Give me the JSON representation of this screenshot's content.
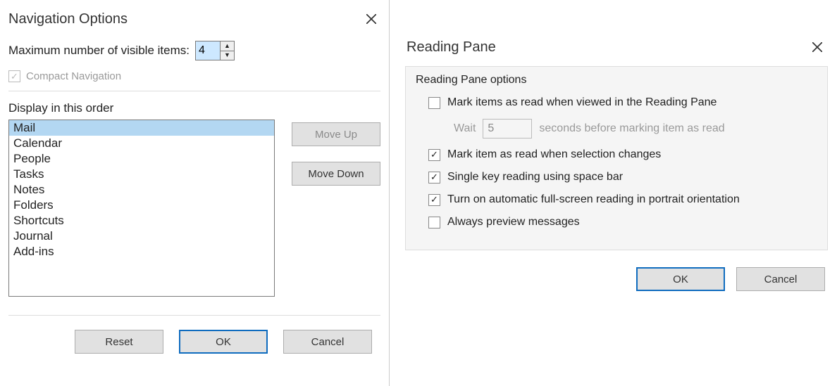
{
  "nav": {
    "title": "Navigation Options",
    "max_label": "Maximum number of visible items:",
    "max_value": "4",
    "compact_label": "Compact Navigation",
    "compact_checked": true,
    "compact_disabled": true,
    "display_label": "Display in this order",
    "items": [
      {
        "label": "Mail",
        "selected": true
      },
      {
        "label": "Calendar",
        "selected": false
      },
      {
        "label": "People",
        "selected": false
      },
      {
        "label": "Tasks",
        "selected": false
      },
      {
        "label": "Notes",
        "selected": false
      },
      {
        "label": "Folders",
        "selected": false
      },
      {
        "label": "Shortcuts",
        "selected": false
      },
      {
        "label": "Journal",
        "selected": false
      },
      {
        "label": "Add-ins",
        "selected": false
      }
    ],
    "move_up": "Move Up",
    "move_down": "Move Down",
    "reset": "Reset",
    "ok": "OK",
    "cancel": "Cancel"
  },
  "rp": {
    "title": "Reading Pane",
    "group_title": "Reading Pane options",
    "opt_mark_viewed": {
      "label": "Mark items as read when viewed in the Reading Pane",
      "checked": false
    },
    "wait_prefix": "Wait",
    "wait_value": "5",
    "wait_suffix": "seconds before marking item as read",
    "opt_mark_selection": {
      "label": "Mark item as read when selection changes",
      "checked": true
    },
    "opt_single_key": {
      "label": "Single key reading using space bar",
      "checked": true
    },
    "opt_fullscreen": {
      "label": "Turn on automatic full-screen reading in portrait orientation",
      "checked": true
    },
    "opt_preview": {
      "label": "Always preview messages",
      "checked": false
    },
    "ok": "OK",
    "cancel": "Cancel"
  }
}
